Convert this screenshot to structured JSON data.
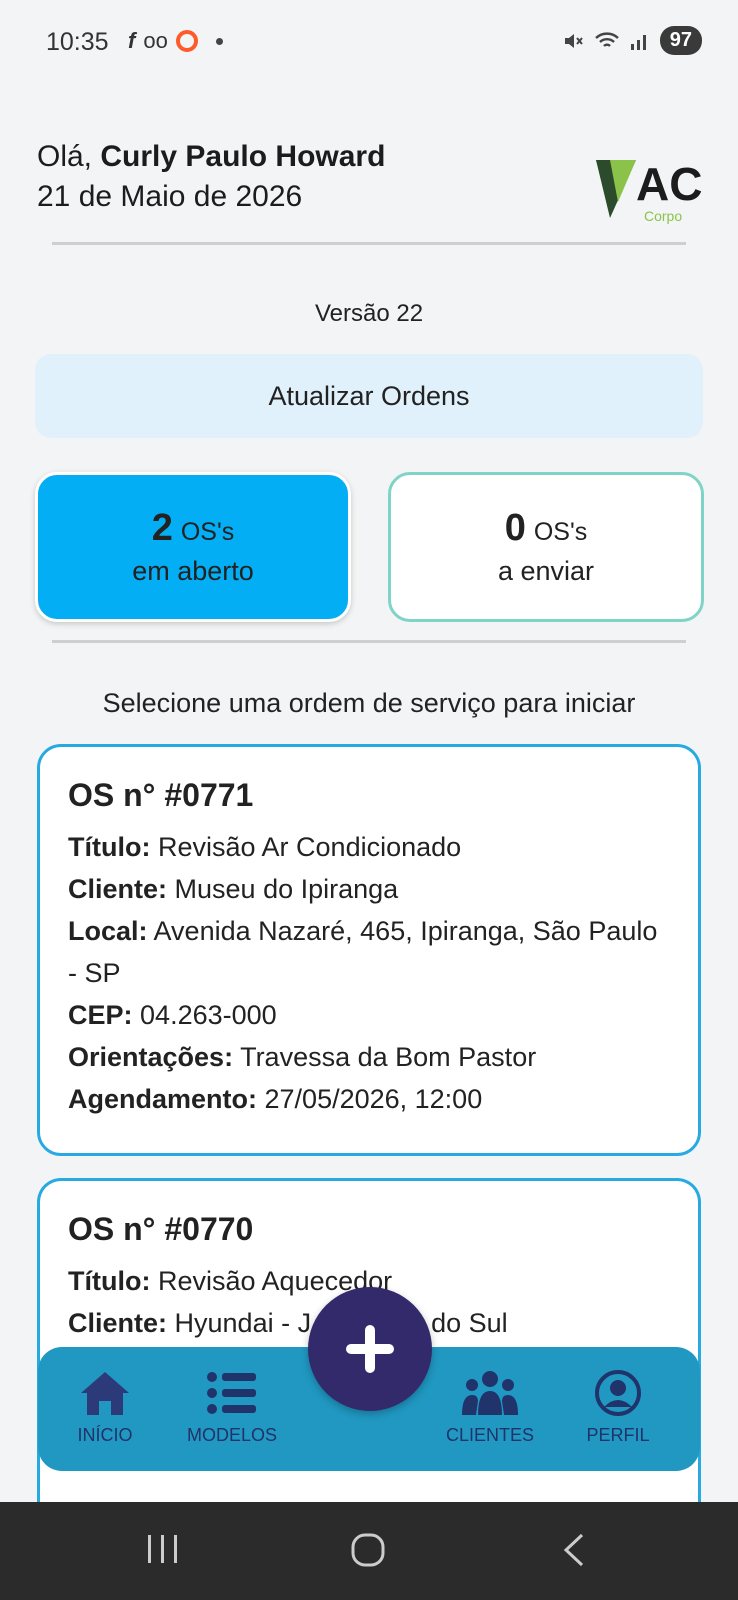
{
  "status_bar": {
    "time": "10:35",
    "battery": "97",
    "icons": [
      "facebook-icon",
      "voicemail-icon",
      "ring-icon",
      "mute-icon",
      "wifi-icon",
      "signal-icon"
    ]
  },
  "header": {
    "greeting_prefix": "Olá,",
    "user_name": "Curly Paulo Howard",
    "date": "21 de Maio de 2026",
    "logo_text": "AC",
    "logo_subtext": "Corpo"
  },
  "version": "Versão 22",
  "update_button": "Atualizar Ordens",
  "counters": {
    "open": {
      "count": "2",
      "unit": "OS's",
      "label": "em aberto"
    },
    "to_send": {
      "count": "0",
      "unit": "OS's",
      "label": "a enviar"
    }
  },
  "prompt": "Selecione uma ordem de serviço para iniciar",
  "orders": [
    {
      "number": "OS n° #0771",
      "title_label": "Título:",
      "title": "Revisão Ar Condicionado",
      "client_label": "Cliente:",
      "client": "Museu do Ipiranga",
      "location_label": "Local:",
      "location": "Avenida Nazaré, 465, Ipiranga, São Paulo - SP",
      "cep_label": "CEP:",
      "cep": "04.263-000",
      "notes_label": "Orientações:",
      "notes": "Travessa da Bom Pastor",
      "schedule_label": "Agendamento:",
      "schedule": "27/05/2026, 12:00"
    },
    {
      "number": "OS n° #0770",
      "title_label": "Título:",
      "title": "Revisão Aquecedor",
      "client_label": "Cliente:",
      "client": "Hyundai - J"
    }
  ],
  "bottom_nav": {
    "items": [
      {
        "label": "INÍCIO",
        "icon": "home-icon"
      },
      {
        "label": "MODELOS",
        "icon": "list-icon"
      },
      {
        "label": "CLIENTES",
        "icon": "users-icon"
      },
      {
        "label": "PERFIL",
        "icon": "profile-icon"
      }
    ],
    "fab_icon": "plus-icon",
    "partial_text": "do Sul"
  },
  "colors": {
    "accent": "#04aef5",
    "card_border": "#27a9e1",
    "nav_bg": "#2098c2",
    "fab_bg": "#332a6b",
    "update_bg": "#e0f1fb"
  }
}
